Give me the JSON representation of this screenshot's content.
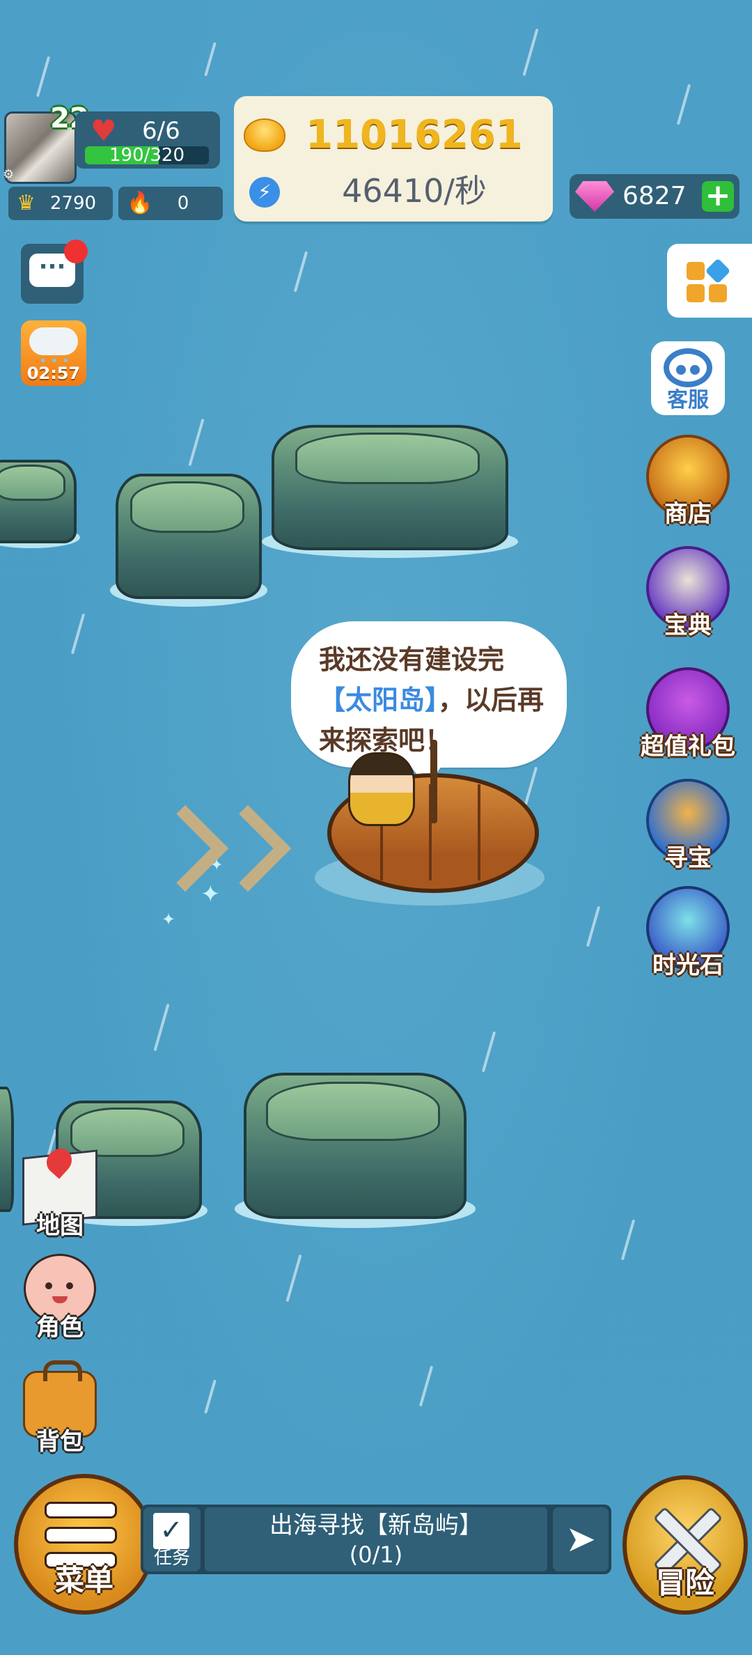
{
  "player": {
    "level": "22",
    "hp_text": "6/6",
    "xp_text": "190/320",
    "xp_fraction": 0.594,
    "crowns": "2790",
    "fire": "0"
  },
  "currency": {
    "coins": "11016261",
    "rate": "46410/秒",
    "gems": "6827"
  },
  "weather": {
    "timer": "02:57"
  },
  "chat": {
    "icon_text": "···"
  },
  "speech_bubble": {
    "line_pre": "我还没有建设完",
    "highlight": "【太阳岛】",
    "line_post": "，以后再来探索吧！"
  },
  "right_menu": [
    {
      "label": "客服",
      "icon": "customer-service-icon"
    },
    {
      "label": "商店",
      "icon": "shop-chest-icon"
    },
    {
      "label": "宝典",
      "icon": "treasure-book-helmet-icon"
    },
    {
      "label": "超值礼包",
      "icon": "gift-box-icon"
    },
    {
      "label": "寻宝",
      "icon": "treasure-chest-icon"
    },
    {
      "label": "时光石",
      "icon": "time-stone-icon"
    }
  ],
  "left_menu": [
    {
      "label": "地图",
      "icon": "map-icon"
    },
    {
      "label": "角色",
      "icon": "character-face-icon"
    },
    {
      "label": "背包",
      "icon": "backpack-icon"
    }
  ],
  "bottom": {
    "menu_label": "菜单",
    "task_icon_label": "任务",
    "task_title": "出海寻找【新岛屿】",
    "task_progress": "(0/1)",
    "adventure_label": "冒险"
  },
  "colors": {
    "sea": "#4a9fc6",
    "panel": "#2f6078",
    "coin_text": "#f0b51e",
    "highlight_blue": "#3a8ae0",
    "hp_bar": "#34c540"
  }
}
